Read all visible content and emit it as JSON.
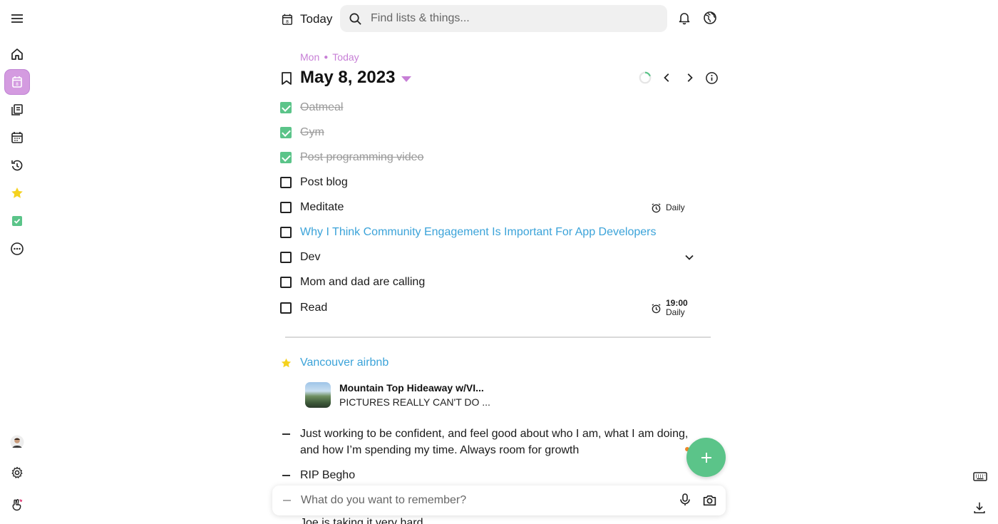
{
  "header": {
    "today_label": "Today",
    "search_placeholder": "Find lists & things..."
  },
  "date": {
    "weekday": "Mon",
    "relative": "Today",
    "title": "May 8, 2023"
  },
  "tasks": [
    {
      "label": "Oatmeal",
      "done": true
    },
    {
      "label": "Gym",
      "done": true
    },
    {
      "label": "Post programming video",
      "done": true
    },
    {
      "label": "Post blog",
      "done": false
    },
    {
      "label": "Meditate",
      "done": false,
      "repeat": "Daily"
    },
    {
      "label": "Why I Think Community Engagement Is Important For App Developers",
      "done": false,
      "link": true
    },
    {
      "label": "Dev",
      "done": false,
      "expandable": true
    },
    {
      "label": "Mom and dad are calling",
      "done": false
    },
    {
      "label": "Read",
      "done": false,
      "time": "19:00",
      "repeat": "Daily"
    }
  ],
  "favorite": {
    "title": "Vancouver airbnb",
    "card_title": "Mountain Top Hideaway w/VI...",
    "card_subtitle": "PICTURES REALLY CAN'T DO ..."
  },
  "notes": [
    "Just working to be confident, and feel good about who I am, what I am doing, and how I’m spending my time. Always room for growth",
    "RIP Begho",
    "Joe is taking it very hard"
  ],
  "composer": {
    "placeholder": "What do you want to remember?"
  },
  "colors": {
    "accent_purple": "#c77fd6",
    "done_green": "#5bc489",
    "link_blue": "#3ba3d9",
    "star_yellow": "#f5d21f"
  }
}
